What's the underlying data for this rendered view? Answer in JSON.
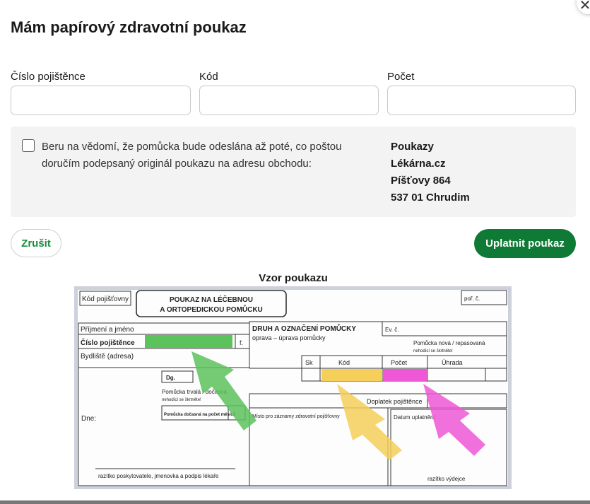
{
  "dialog": {
    "title": "Mám papírový zdravotní poukaz",
    "close_icon": "close-icon"
  },
  "fields": {
    "insurance_number": {
      "label": "Číslo pojištěnce",
      "value": "",
      "placeholder": ""
    },
    "code": {
      "label": "Kód",
      "value": "",
      "placeholder": ""
    },
    "count": {
      "label": "Počet",
      "value": "",
      "placeholder": ""
    }
  },
  "notice": {
    "checked": false,
    "text": "Beru na vědomí, že pomůcka bude odeslána až poté, co poštou doručím podepsaný originál poukazu na adresu obchodu:",
    "address": [
      "Poukazy",
      "Lékárna.cz",
      "Píšťovy 864",
      "537 01 Chrudim"
    ]
  },
  "buttons": {
    "cancel": "Zrušit",
    "submit": "Uplatnit poukaz"
  },
  "sample": {
    "title": "Vzor poukazu",
    "form": {
      "insurer_code": "Kód pojišťovny",
      "header_line1": "POUKAZ NA LÉČEBNOU",
      "header_line2": "A ORTOPEDICKOU POMŮCKU",
      "ref_no": "poř. č.",
      "name": "Příjmení a jméno",
      "insured_no": "Číslo pojištěnce",
      "f": "f.",
      "address": "Bydliště (adresa)",
      "dg": "Dg.",
      "aid_type": "Pomůcka trvalá / dočasná",
      "strike_note": "nehodící se škrtněte!",
      "temp_count": "Pomůcka dočasná na počet měsíců",
      "date": "Dne:",
      "stamp_doctor": "razítko poskytovatele, jmenovka a podpis lékaře",
      "aid_type_header": "DRUH A OZNAČENÍ POMŮCKY",
      "ev_no": "Ev. č.",
      "repair": "oprava – úprava pomůcky",
      "new_repaired": "Pomůcka nová / repasovaná",
      "col_sk": "Sk",
      "col_code": "Kód",
      "col_count": "Počet",
      "col_payment": "Úhrada",
      "copay": "Doplatek pojištěnce",
      "records": "Místo pro záznamy zdravotní pojišťovny",
      "date_applied": "Datum uplatnění:",
      "stamp_issuer": "razítko výdejce"
    },
    "highlight_colors": {
      "insured_no": "#5cc25c",
      "code": "#f5cf5a",
      "count": "#ee58d6"
    }
  },
  "colors": {
    "accent": "#0f7a35",
    "notice_bg": "#f3f3f3"
  }
}
